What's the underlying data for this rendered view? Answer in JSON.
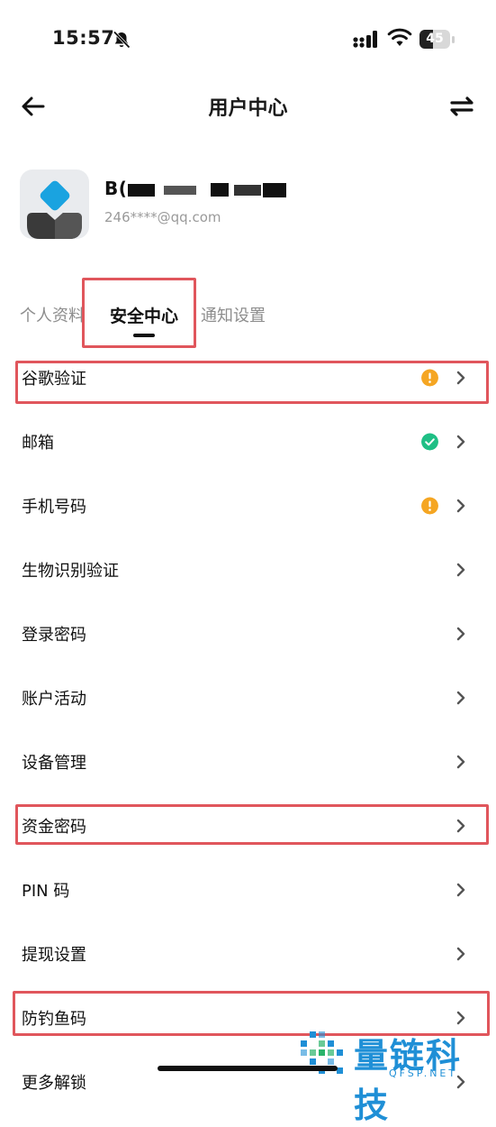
{
  "status_bar": {
    "time": "15:57",
    "battery": "45",
    "battery_percent": 45
  },
  "header": {
    "title": "用户中心"
  },
  "profile": {
    "name": "B(",
    "email": "246****@qq.com"
  },
  "tabs": [
    {
      "label": "个人资料",
      "active": false
    },
    {
      "label": "安全中心",
      "active": true
    },
    {
      "label": "通知设置",
      "active": false
    }
  ],
  "security_items": [
    {
      "label": "谷歌验证",
      "status": "warning"
    },
    {
      "label": "邮箱",
      "status": "ok"
    },
    {
      "label": "手机号码",
      "status": "warning"
    },
    {
      "label": "生物识别验证",
      "status": ""
    },
    {
      "label": "登录密码",
      "status": ""
    },
    {
      "label": "账户活动",
      "status": ""
    },
    {
      "label": "设备管理",
      "status": ""
    },
    {
      "label": "资金密码",
      "status": ""
    },
    {
      "label": "PIN 码",
      "status": ""
    },
    {
      "label": "提现设置",
      "status": ""
    },
    {
      "label": "防钓鱼码",
      "status": ""
    },
    {
      "label": "更多解锁",
      "status": ""
    }
  ],
  "colors": {
    "warning": "#f5a623",
    "ok": "#1fbf85",
    "annotation": "#e0565c",
    "watermark": "#1f8fd6"
  },
  "watermark": {
    "text": "量链科技",
    "sub": "QFSP.NET"
  }
}
